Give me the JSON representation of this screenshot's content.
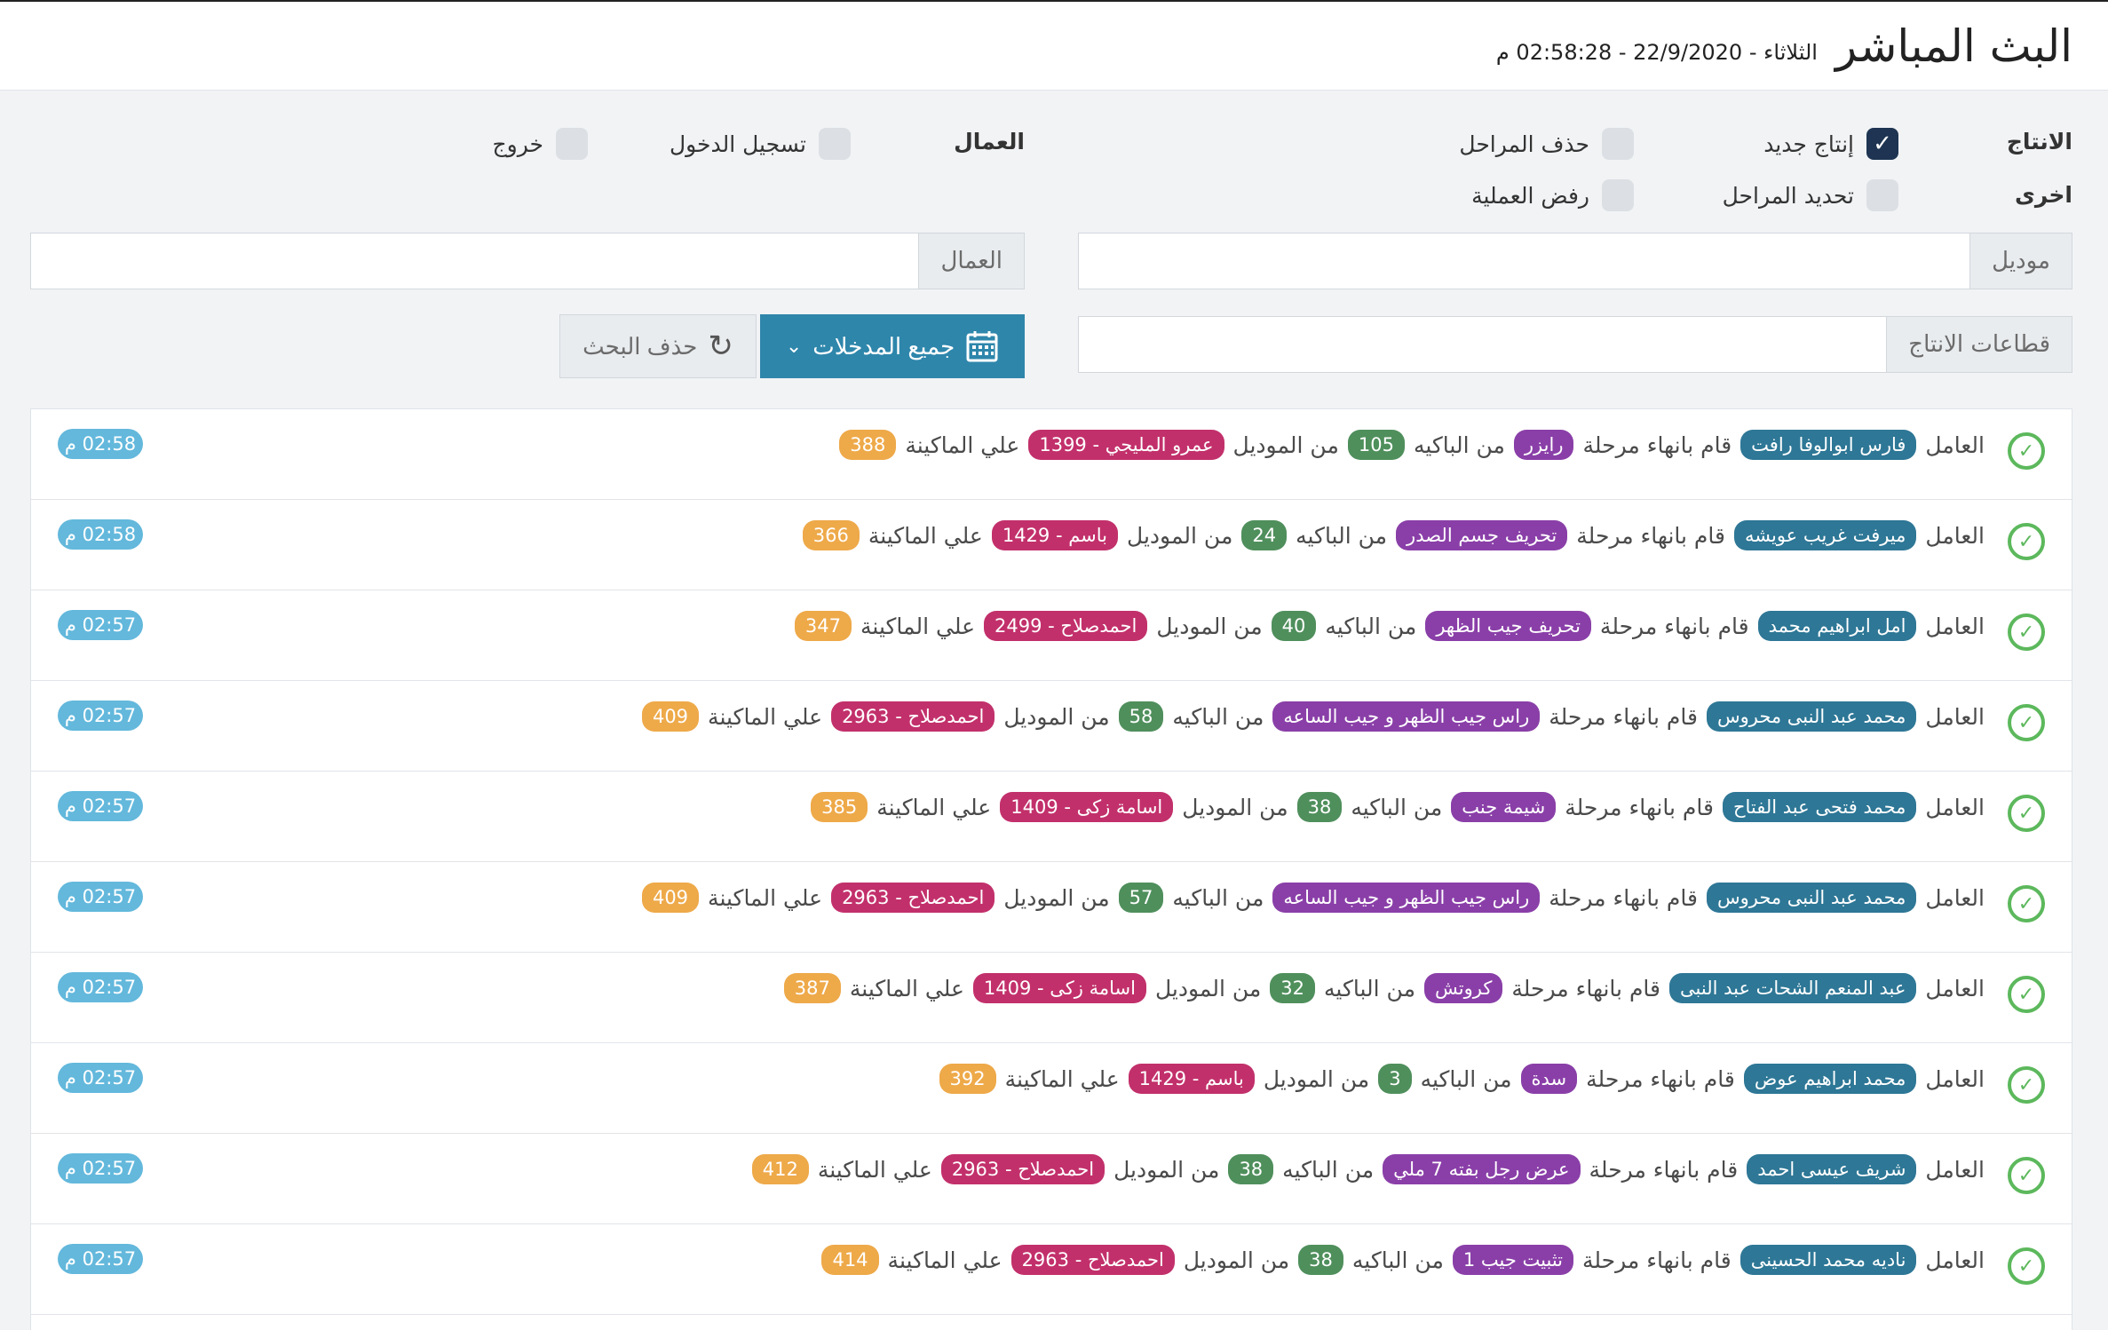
{
  "header": {
    "title": "البث المباشر",
    "datetime": "الثلاثاء - 22/9/2020 - 02:58:28 م"
  },
  "filters": {
    "production_label": "الانتاج",
    "other_label": "اخرى",
    "workers_label": "العمال",
    "options": {
      "new_production": "إنتاج جديد",
      "delete_stages": "حذف المراحل",
      "define_stages": "تحديد المراحل",
      "reject_operation": "رفض العملية",
      "login": "تسجيل الدخول",
      "logout": "خروج"
    },
    "checked": {
      "new_production": true,
      "delete_stages": false,
      "define_stages": false,
      "reject_operation": false,
      "login": false,
      "logout": false
    }
  },
  "inputs": {
    "model_addon": "موديل",
    "workers_addon": "العمال",
    "sectors_addon": "قطاعات الانتاج"
  },
  "buttons": {
    "all_entries": "جميع المدخلات",
    "clear_search": "حذف البحث"
  },
  "phrases": {
    "worker": "العامل",
    "finished_stage": "قام بانهاء مرحلة",
    "from_batch": "من الباكيه",
    "from_model": "من الموديل",
    "on_machine": "علي الماكينة"
  },
  "feed": [
    {
      "worker": "فارس ابوالوفا رافت",
      "stage": "رايزر",
      "batch": "105",
      "model": "عمرو المليجي - 1399",
      "machine": "388",
      "time": "02:58 م"
    },
    {
      "worker": "ميرفت غريب عويشه",
      "stage": "تحريف جسم الصدر",
      "batch": "24",
      "model": "باسم - 1429",
      "machine": "366",
      "time": "02:58 م"
    },
    {
      "worker": "امل ابراهيم محمد",
      "stage": "تحريف جيب الظهر",
      "batch": "40",
      "model": "احمدصلاح - 2499",
      "machine": "347",
      "time": "02:57 م"
    },
    {
      "worker": "محمد عبد النبى محروس",
      "stage": "راس جيب الظهر و جيب الساعه",
      "batch": "58",
      "model": "احمدصلاح - 2963",
      "machine": "409",
      "time": "02:57 م"
    },
    {
      "worker": "محمد فتحى عبد الفتاح",
      "stage": "شيمة جنب",
      "batch": "38",
      "model": "اسامة زكى - 1409",
      "machine": "385",
      "time": "02:57 م"
    },
    {
      "worker": "محمد عبد النبى محروس",
      "stage": "راس جيب الظهر و جيب الساعه",
      "batch": "57",
      "model": "احمدصلاح - 2963",
      "machine": "409",
      "time": "02:57 م"
    },
    {
      "worker": "عبد المنعم الشحات عبد النبى",
      "stage": "كروتش",
      "batch": "32",
      "model": "اسامة زكى - 1409",
      "machine": "387",
      "time": "02:57 م"
    },
    {
      "worker": "محمد ابراهيم عوض",
      "stage": "سدة",
      "batch": "3",
      "model": "باسم - 1429",
      "machine": "392",
      "time": "02:57 م"
    },
    {
      "worker": "شريف عيسى احمد",
      "stage": "عرض رجل بفته 7 ملي",
      "batch": "38",
      "model": "احمدصلاح - 2963",
      "machine": "412",
      "time": "02:57 م"
    },
    {
      "worker": "ناديه محمد الحسينى",
      "stage": "تثبيت جيب 1",
      "batch": "38",
      "model": "احمدصلاح - 2963",
      "machine": "414",
      "time": "02:57 م"
    }
  ]
}
